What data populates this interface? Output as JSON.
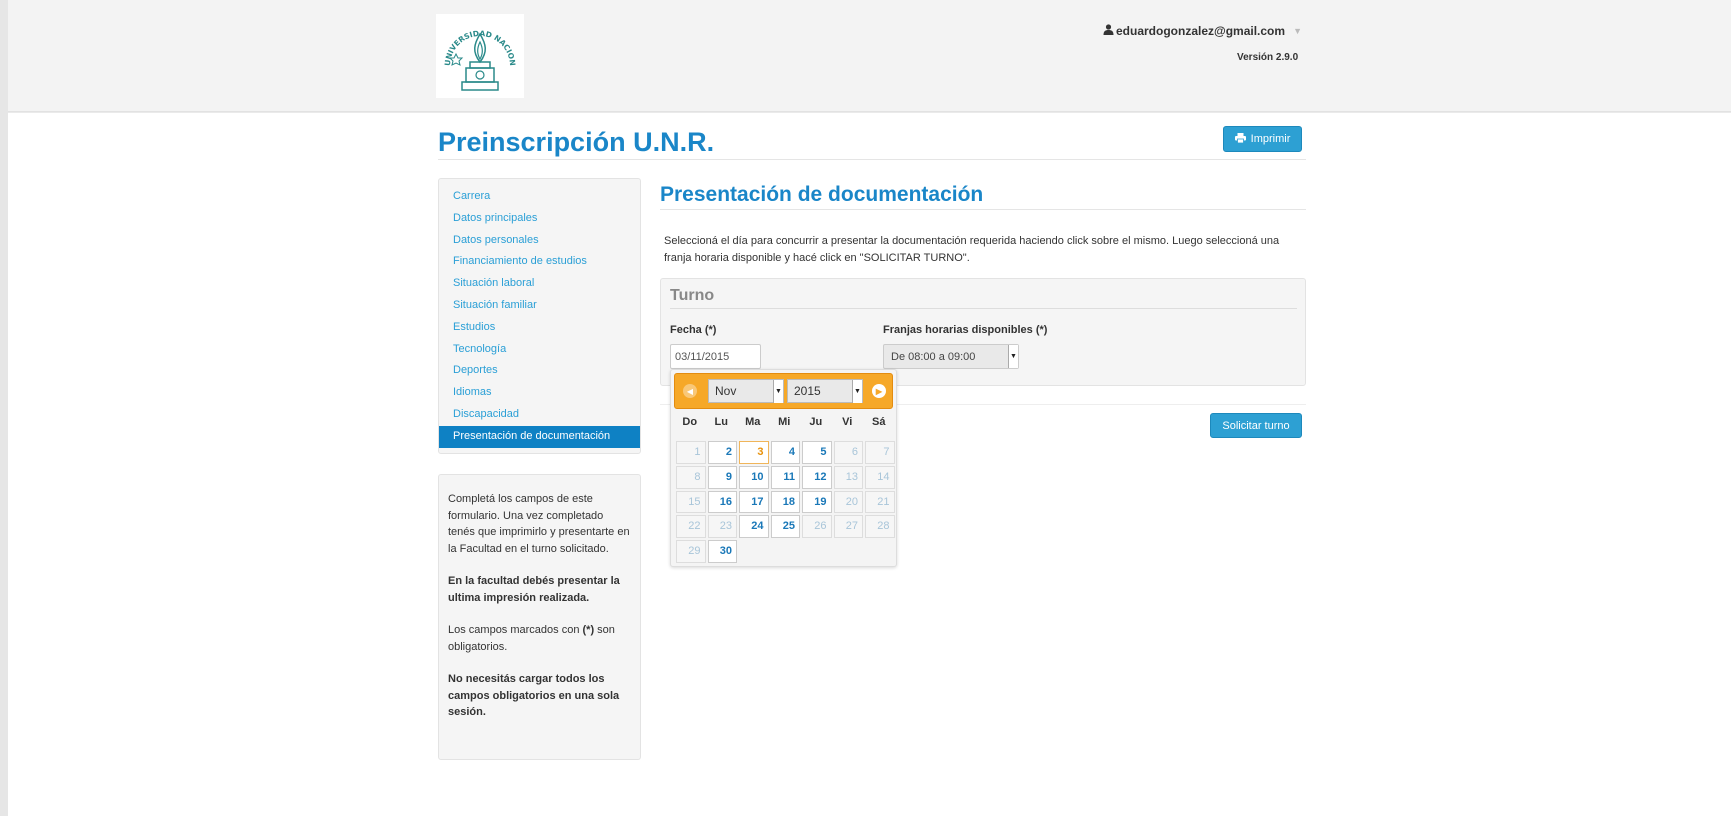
{
  "header": {
    "logo_text": "UNIVERSIDAD NACIONAL DE ROSARIO",
    "user_email": "eduardogonzalez@gmail.com",
    "version": "Versión 2.9.0"
  },
  "page": {
    "title": "Preinscripción U.N.R.",
    "print_label": "Imprimir"
  },
  "sidebar": {
    "items": [
      {
        "label": "Carrera"
      },
      {
        "label": "Datos principales"
      },
      {
        "label": "Datos personales"
      },
      {
        "label": "Financiamiento de estudios"
      },
      {
        "label": "Situación laboral"
      },
      {
        "label": "Situación familiar"
      },
      {
        "label": "Estudios"
      },
      {
        "label": "Tecnología"
      },
      {
        "label": "Deportes"
      },
      {
        "label": "Idiomas"
      },
      {
        "label": "Discapacidad"
      },
      {
        "label": "Presentación de documentación"
      }
    ],
    "active_index": 11
  },
  "help": {
    "p1": "Completá los campos de este formulario. Una vez completado tenés que imprimirlo y presentarte en la Facultad en el turno solicitado.",
    "p2": "En la facultad debés presentar la ultima impresión realizada.",
    "p3_prefix": "Los campos marcados con ",
    "p3_mark": "(*)",
    "p3_suffix": " son obligatorios.",
    "p4": "No necesitás cargar todos los campos obligatorios en una sola sesión."
  },
  "main": {
    "section_title": "Presentación de documentación",
    "instructions": "Seleccioná el día para concurrir a presentar la documentación requerida haciendo click sobre el mismo. Luego seleccioná una franja horaria disponible y hacé click en \"SOLICITAR TURNO\".",
    "legend": "Turno",
    "date_label": "Fecha (*)",
    "date_value": "03/11/2015",
    "time_label": "Franjas horarias disponibles (*)",
    "time_value": "De 08:00 a 09:00",
    "submit_label": "Solicitar turno"
  },
  "datepicker": {
    "month": "Nov",
    "year": "2015",
    "weekdays": [
      "Do",
      "Lu",
      "Ma",
      "Mi",
      "Ju",
      "Vi",
      "Sá"
    ],
    "days": [
      {
        "n": "1",
        "s": "disabled"
      },
      {
        "n": "2",
        "s": "avail"
      },
      {
        "n": "3",
        "s": "today"
      },
      {
        "n": "4",
        "s": "avail"
      },
      {
        "n": "5",
        "s": "avail"
      },
      {
        "n": "6",
        "s": "disabled"
      },
      {
        "n": "7",
        "s": "disabled"
      },
      {
        "n": "8",
        "s": "disabled"
      },
      {
        "n": "9",
        "s": "avail"
      },
      {
        "n": "10",
        "s": "avail"
      },
      {
        "n": "11",
        "s": "avail"
      },
      {
        "n": "12",
        "s": "avail"
      },
      {
        "n": "13",
        "s": "disabled"
      },
      {
        "n": "14",
        "s": "disabled"
      },
      {
        "n": "15",
        "s": "disabled"
      },
      {
        "n": "16",
        "s": "avail"
      },
      {
        "n": "17",
        "s": "avail"
      },
      {
        "n": "18",
        "s": "avail"
      },
      {
        "n": "19",
        "s": "avail"
      },
      {
        "n": "20",
        "s": "disabled"
      },
      {
        "n": "21",
        "s": "disabled"
      },
      {
        "n": "22",
        "s": "disabled"
      },
      {
        "n": "23",
        "s": "disabled"
      },
      {
        "n": "24",
        "s": "avail"
      },
      {
        "n": "25",
        "s": "avail"
      },
      {
        "n": "26",
        "s": "disabled"
      },
      {
        "n": "27",
        "s": "disabled"
      },
      {
        "n": "28",
        "s": "disabled"
      },
      {
        "n": "29",
        "s": "disabled"
      },
      {
        "n": "30",
        "s": "avail"
      }
    ]
  },
  "colors": {
    "accent": "#1a86c8",
    "button": "#2da0d3",
    "datepicker_header": "#f6a828"
  }
}
